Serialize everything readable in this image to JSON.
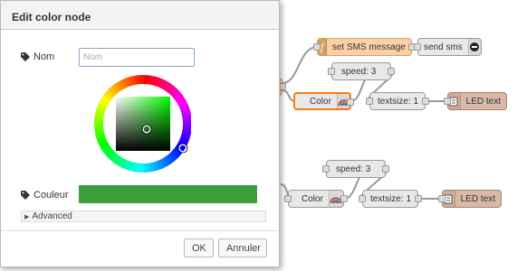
{
  "canvas": {
    "nodes": {
      "set_sms": "set SMS message",
      "send_sms": "send sms",
      "speed1": "speed: 3",
      "color1": "Color",
      "textsize1": "textsize: 1",
      "led1": "LED text",
      "speed2": "speed: 3",
      "color2": "Color",
      "textsize2": "textsize: 1",
      "led2": "LED text"
    }
  },
  "dialog": {
    "title": "Edit color node",
    "name_label": "Nom",
    "name_value": "",
    "name_placeholder": "Nom",
    "color_label": "Couleur",
    "color_value": "#3ba03b",
    "advanced_label": "Advanced",
    "ok_label": "OK",
    "cancel_label": "Annuler"
  },
  "colors": {
    "function_node": "#fdd0a2",
    "led_node": "#d9b8a6",
    "selected_outline": "#ff7f0e"
  }
}
